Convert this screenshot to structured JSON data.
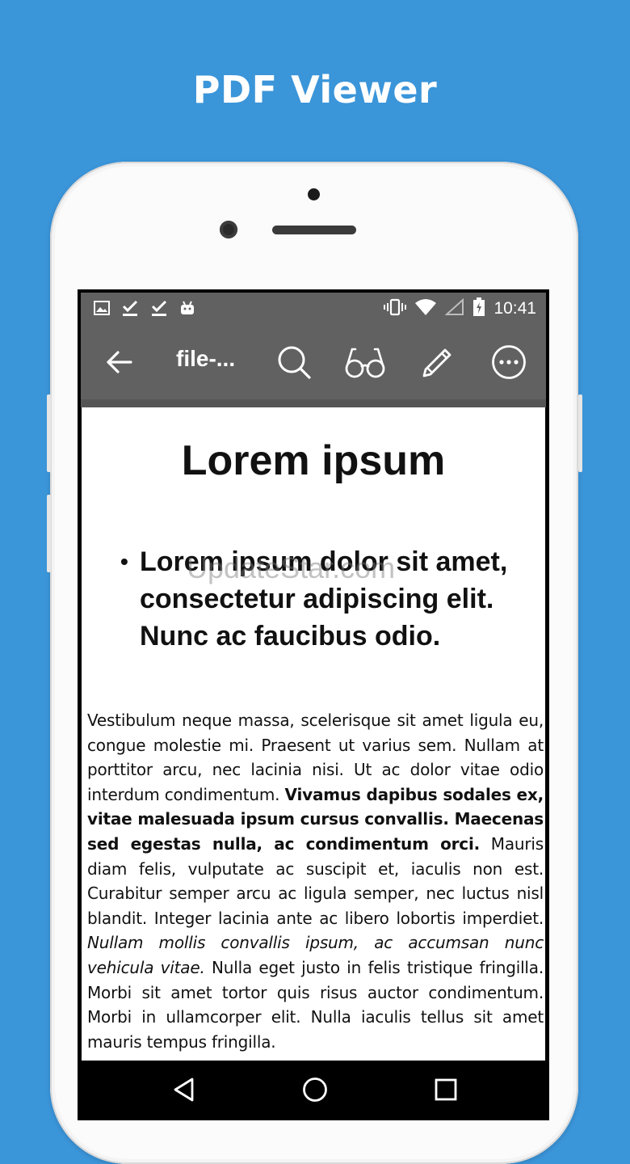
{
  "banner": {
    "title": "PDF Viewer"
  },
  "status_bar": {
    "time": "10:41",
    "notification_icons": [
      "image-icon",
      "download-done-icon",
      "download-done-icon",
      "android-icon"
    ],
    "system_icons": [
      "vibrate-icon",
      "wifi-icon",
      "cellular-signal-icon",
      "battery-charging-icon"
    ]
  },
  "toolbar": {
    "file_name": "file-...",
    "actions": [
      "back-arrow-icon",
      "search-icon",
      "reading-glasses-icon",
      "pencil-icon",
      "more-options-icon"
    ]
  },
  "document": {
    "title": "Lorem ipsum",
    "bullet": "Lorem ipsum dolor sit amet, consectetur adipiscing elit. Nunc ac faucibus odio.",
    "watermark": "UpdateStar.com",
    "paragraph": {
      "part1": "Vestibulum neque massa, scelerisque sit amet ligula eu, congue molestie mi. Praesent ut varius sem. Nullam at porttitor arcu, nec lacinia nisi. Ut ac dolor vitae odio interdum condimentum. ",
      "bold": "Vivamus dapibus sodales ex, vitae malesuada ipsum cursus convallis. Maecenas sed egestas nulla, ac condimentum orci.",
      "part2": " Mauris diam felis, vulputate ac suscipit et, iaculis non est. Curabitur semper arcu ac ligula semper, nec luctus nisl blandit. Integer lacinia ante ac libero lobortis imperdiet. ",
      "italic": "Nullam mollis convallis ipsum, ac accumsan nunc vehicula vitae.",
      "part3": " Nulla eget justo in felis tristique fringilla. Morbi sit amet tortor quis risus auctor condimentum. Morbi in ullamcorper elit. Nulla iaculis tellus sit amet mauris tempus fringilla."
    }
  },
  "nav_bar": {
    "buttons": [
      "back-triangle-icon",
      "home-circle-icon",
      "recents-square-icon"
    ]
  },
  "colors": {
    "background": "#3b95d9",
    "toolbar": "#616161",
    "page": "#ffffff"
  }
}
